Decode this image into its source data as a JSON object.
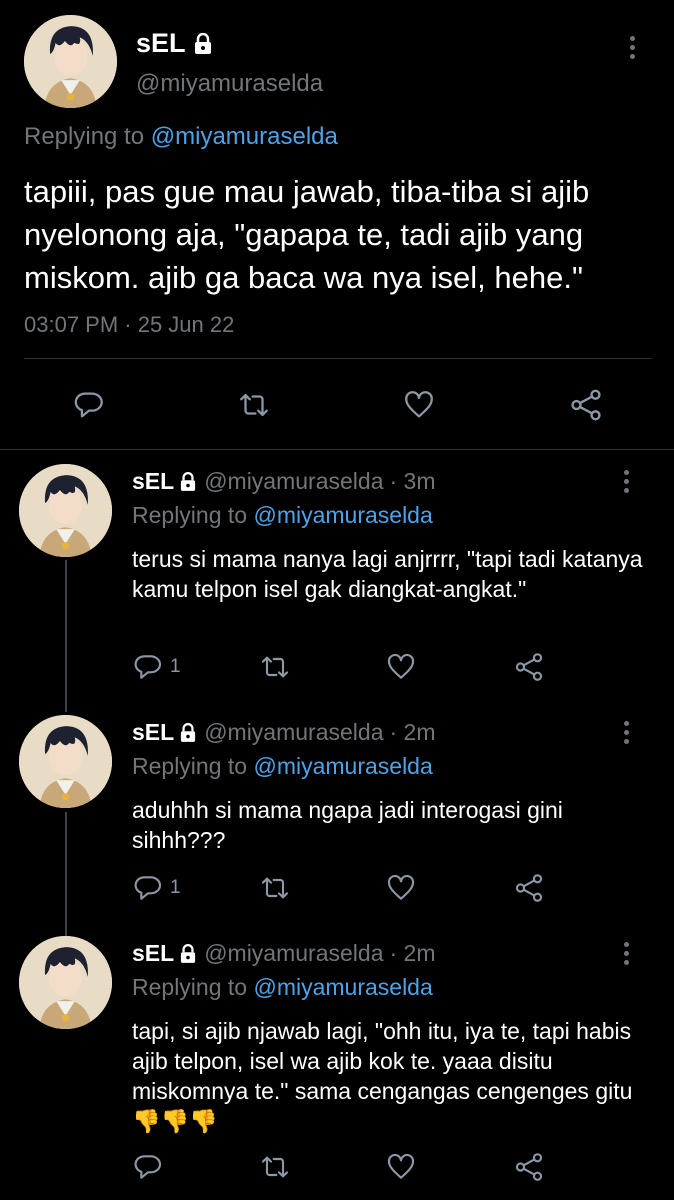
{
  "main_tweet": {
    "name": "sEL",
    "handle": "@miyamuraselda",
    "replying_prefix": "Replying to",
    "replying_to": "@miyamuraselda",
    "text": "tapiii, pas gue mau jawab, tiba-tiba si ajib nyelonong aja, \"gapapa te, tadi ajib yang miskom. ajib ga baca wa nya isel, hehe.\"",
    "timestamp": "03:07 PM · 25 Jun 22",
    "icons": [
      "reply-icon",
      "retweet-icon",
      "like-icon",
      "share-icon"
    ]
  },
  "replies": [
    {
      "name": "sEL",
      "handle": "@miyamuraselda",
      "time": "· 3m",
      "replying_prefix": "Replying to",
      "replying_to": "@miyamuraselda",
      "text": "terus si mama nanya lagi anjrrrr, \"tapi tadi katanya kamu telpon isel gak diangkat-angkat.\"",
      "reply_count": "1"
    },
    {
      "name": "sEL",
      "handle": "@miyamuraselda",
      "time": "· 2m",
      "replying_prefix": "Replying to",
      "replying_to": "@miyamuraselda",
      "text": "aduhhh si mama ngapa jadi interogasi gini sihhh???",
      "reply_count": "1"
    },
    {
      "name": "sEL",
      "handle": "@miyamuraselda",
      "time": "· 2m",
      "replying_prefix": "Replying to",
      "replying_to": "@miyamuraselda",
      "text": "tapi, si ajib njawab lagi, \"ohh itu, iya te, tapi habis ajib telpon, isel wa ajib kok te. yaaa disitu miskomnya te.\" sama cengangas cengenges gitu👎👎👎",
      "reply_count": ""
    }
  ],
  "colors": {
    "background": "#000000",
    "text": "#e7e9ea",
    "secondary": "#71767b",
    "link": "#4da3e6",
    "divider": "#2f3336"
  }
}
